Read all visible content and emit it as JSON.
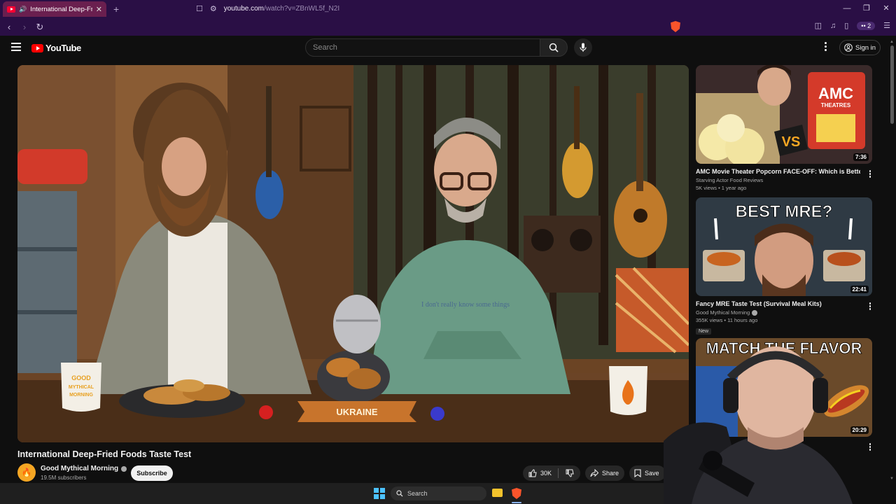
{
  "browser": {
    "tab_title": "International Deep-Fried Foods Taste Test",
    "new_tab": "+",
    "url_host": "youtube.com",
    "url_path": "/watch?v=ZBnWL5f_N2I",
    "wallet_count": "2"
  },
  "youtube": {
    "logo_text": "YouTube",
    "search_placeholder": "Search",
    "sign_in": "Sign in"
  },
  "video": {
    "title": "International Deep-Fried Foods Taste Test",
    "channel": "Good Mythical Morning",
    "subscribers": "19.5M subscribers",
    "subscribe_label": "Subscribe",
    "likes": "30K",
    "share_label": "Share",
    "save_label": "Save",
    "on_screen": {
      "mug_text": "GOOD MYTHICAL MORNING",
      "banner_text": "UKRAINE",
      "shirt_text": "I don't really know some things"
    }
  },
  "recommended": [
    {
      "title": "AMC Movie Theater Popcorn FACE-OFF: Which is Better?",
      "channel": "Starving Actor Food Reviews",
      "meta": "5K views • 1 year ago",
      "duration": "7:36",
      "thumb_text": "AMC",
      "thumb_sub": "THEATRES",
      "thumb_vs": "VS",
      "verified": false,
      "badge": ""
    },
    {
      "title": "Fancy MRE Taste Test (Survival Meal Kits)",
      "channel": "Good Mythical Morning",
      "meta": "355K views • 11 hours ago",
      "duration": "22:41",
      "thumb_text": "BEST MRE?",
      "verified": true,
      "badge": "New"
    },
    {
      "title": "",
      "channel": "",
      "meta": "",
      "duration": "20:29",
      "thumb_text": "MATCH THE FLAVOR",
      "verified": false,
      "badge": ""
    }
  ],
  "taskbar": {
    "search_label": "Search"
  },
  "colors": {
    "browser_chrome": "#2a0f45",
    "tab_active": "#6a1f4f",
    "yt_red": "#ff0000",
    "page_bg": "#0f0f0f"
  }
}
